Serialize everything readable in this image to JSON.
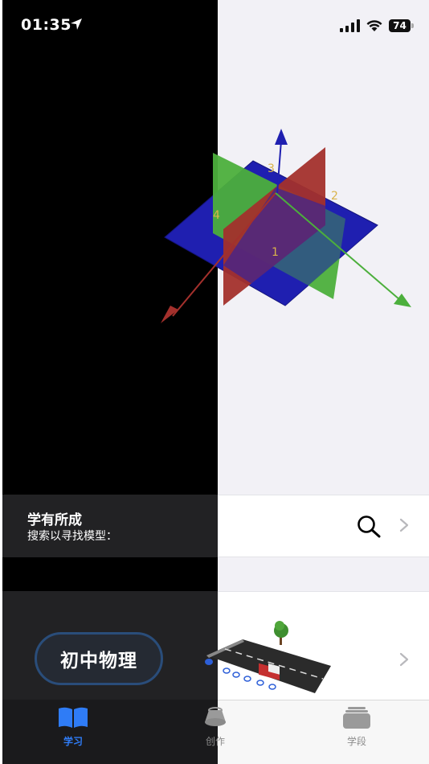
{
  "status_bar": {
    "time": "01:35",
    "battery": "74"
  },
  "model_labels": [
    "1",
    "2",
    "3",
    "4"
  ],
  "search": {
    "title": "学有所成",
    "subtitle": "搜索以寻找模型："
  },
  "course": {
    "label": "初中物理"
  },
  "tabs": [
    {
      "label": "学习",
      "icon": "book-icon",
      "active": true
    },
    {
      "label": "创作",
      "icon": "create-icon",
      "active": false
    },
    {
      "label": "学段",
      "icon": "stack-icon",
      "active": false
    }
  ],
  "colors": {
    "accent": "#2f7cf6",
    "plane_blue": "#1f1fb0",
    "plane_green": "#4caf3c",
    "plane_red": "#a3302c"
  }
}
